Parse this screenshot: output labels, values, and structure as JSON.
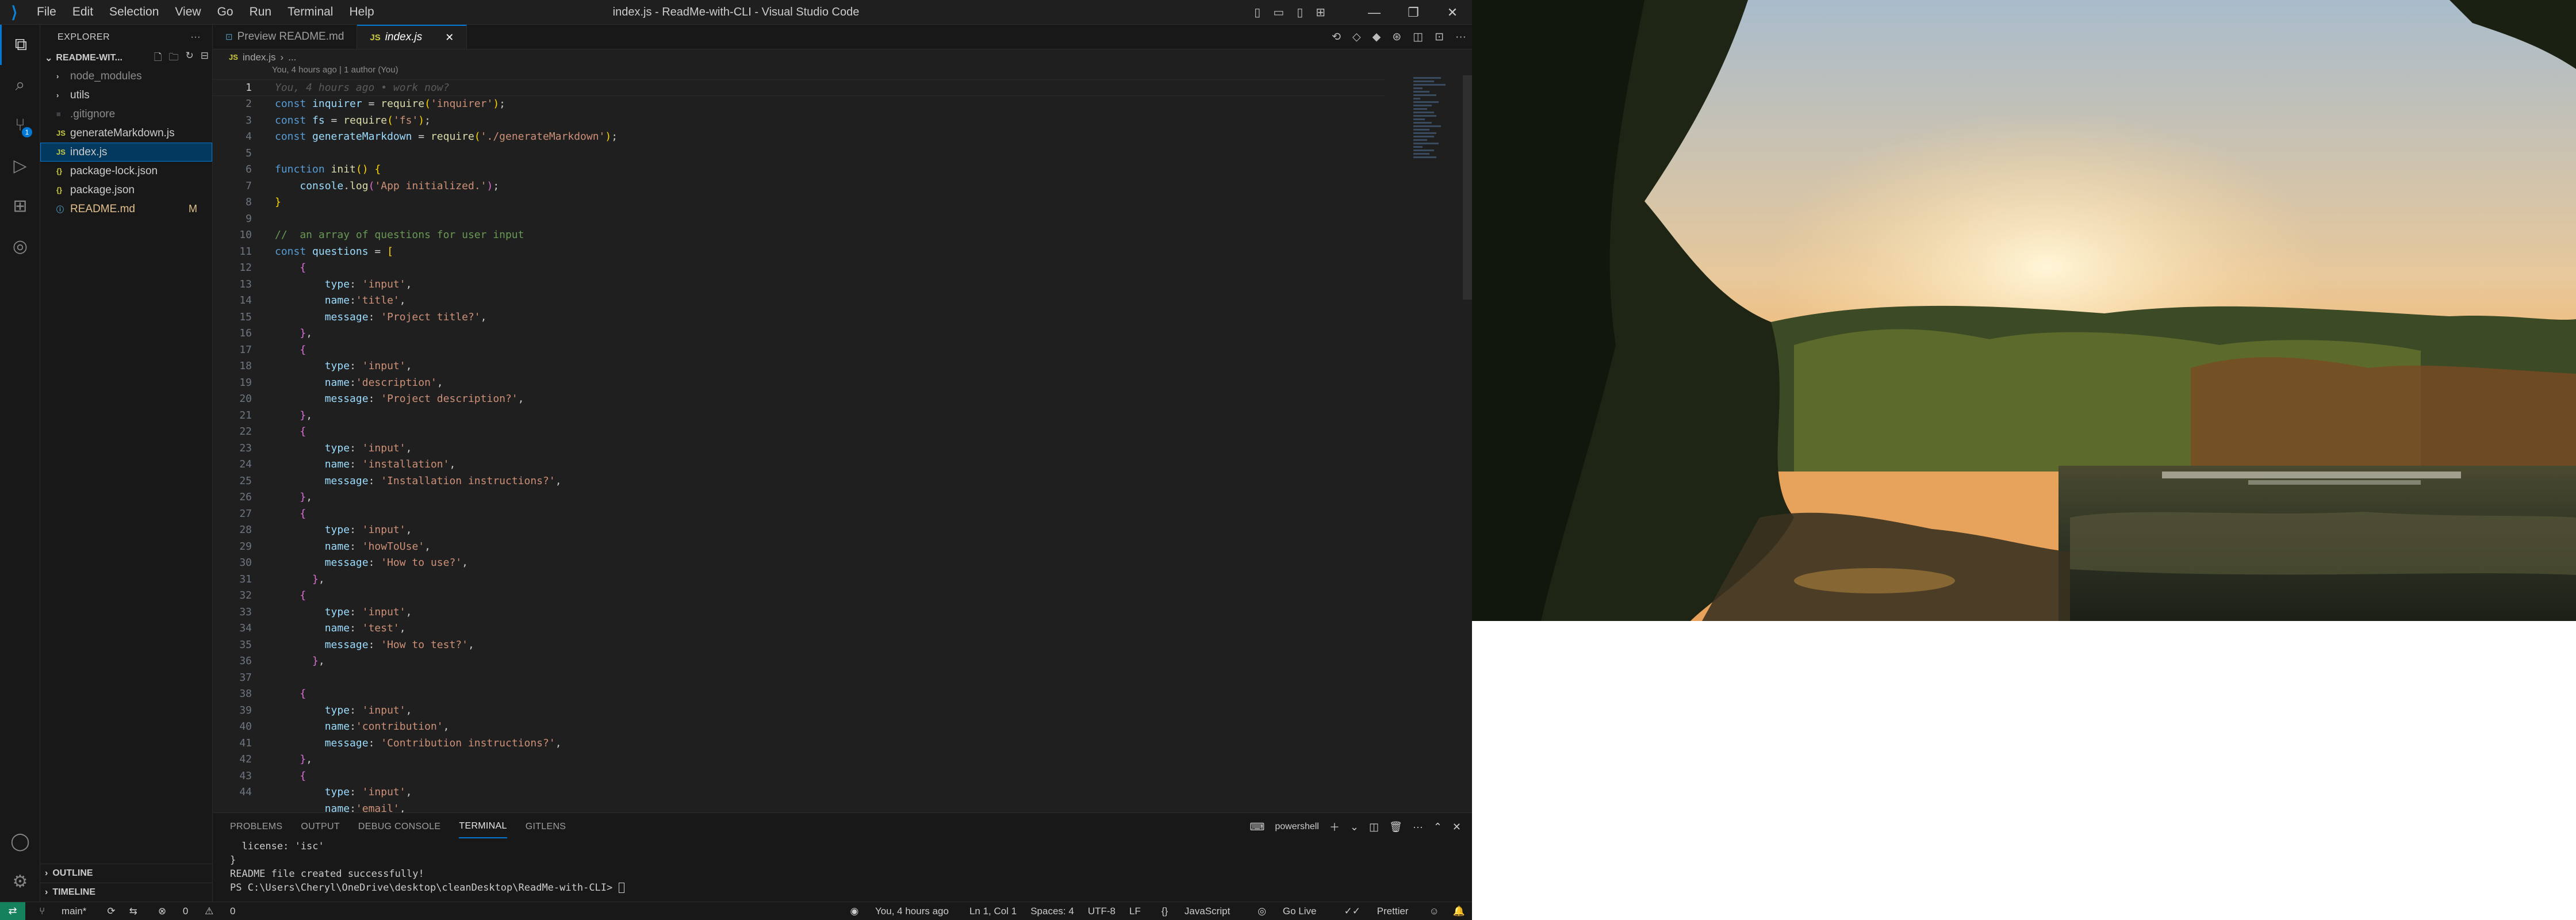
{
  "window": {
    "title": "index.js - ReadMe-with-CLI - Visual Studio Code",
    "menu": [
      "File",
      "Edit",
      "Selection",
      "View",
      "Go",
      "Run",
      "Terminal",
      "Help"
    ]
  },
  "sidebar": {
    "header": "EXPLORER",
    "project": "README-WIT...",
    "items": [
      {
        "name": "node_modules",
        "type": "folder"
      },
      {
        "name": "utils",
        "type": "folder"
      },
      {
        "name": ".gitignore",
        "type": "file"
      },
      {
        "name": "generateMarkdown.js",
        "type": "js"
      },
      {
        "name": "index.js",
        "type": "js"
      },
      {
        "name": "package-lock.json",
        "type": "json"
      },
      {
        "name": "package.json",
        "type": "json"
      },
      {
        "name": "README.md",
        "type": "md",
        "status": "M"
      }
    ],
    "outline": "OUTLINE",
    "timeline": "TIMELINE"
  },
  "tabs": [
    {
      "label": "Preview README.md"
    },
    {
      "label": "index.js"
    }
  ],
  "breadcrumb": {
    "file": "index.js",
    "more": "..."
  },
  "blame": "You, 4 hours ago | 1 author (You)",
  "editor": {
    "ghost_line1": "You, 4 hours ago • work now?",
    "line_numbers": [
      "1",
      "2",
      "3",
      "4",
      "5",
      "6",
      "7",
      "8",
      "9",
      "10",
      "11",
      "12",
      "13",
      "14",
      "15",
      "16",
      "17",
      "18",
      "19",
      "20",
      "21",
      "22",
      "23",
      "24",
      "25",
      "26",
      "27",
      "28",
      "29",
      "30",
      "31",
      "32",
      "33",
      "34",
      "35",
      "36",
      "37",
      "38",
      "39",
      "40",
      "41",
      "42",
      "43",
      "44"
    ]
  },
  "panel": {
    "tabs": [
      "PROBLEMS",
      "OUTPUT",
      "DEBUG CONSOLE",
      "TERMINAL",
      "GITLENS"
    ],
    "active": "TERMINAL",
    "shell": "powershell",
    "terminal_lines": [
      "  license: 'isc'",
      "}",
      "README file created successfully!",
      "PS C:\\Users\\Cheryl\\OneDrive\\desktop\\cleanDesktop\\ReadMe-with-CLI> "
    ]
  },
  "status": {
    "branch": "main*",
    "errors": "0",
    "warnings": "0",
    "blame": "You, 4 hours ago",
    "cursor": "Ln 1, Col 1",
    "spaces": "Spaces: 4",
    "encoding": "UTF-8",
    "eol": "LF",
    "language": "JavaScript",
    "golive": "Go Live",
    "prettier": "Prettier"
  },
  "colors": {
    "accent": "#0078d4",
    "remote": "#16825d",
    "modified": "#e2c08d"
  }
}
